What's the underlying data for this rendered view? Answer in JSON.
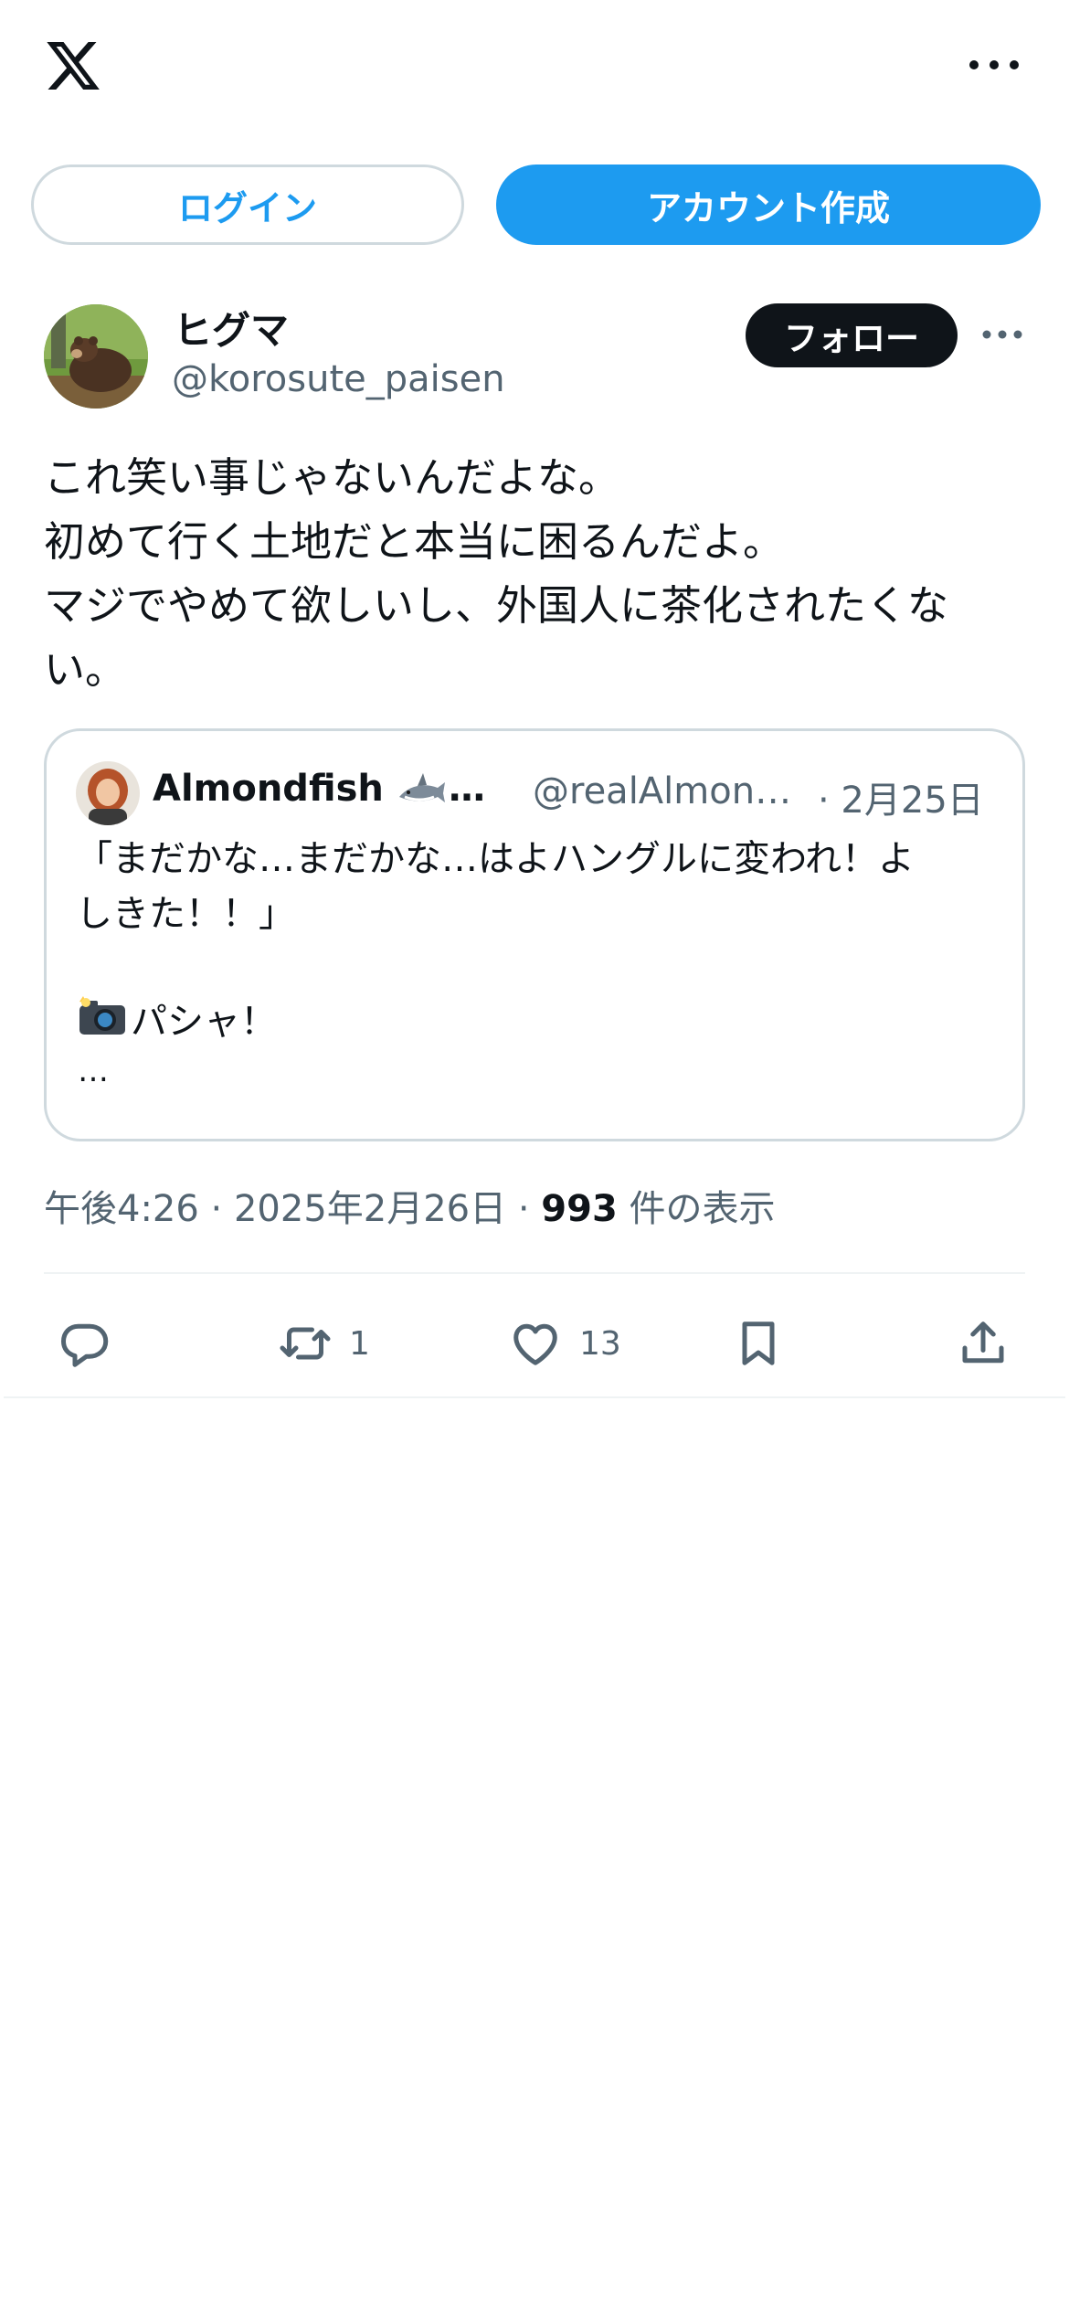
{
  "header": {
    "logo_icon": "x-logo-icon",
    "more_icon": "more-horizontal-icon"
  },
  "auth": {
    "login_label": "ログイン",
    "signup_label": "アカウント作成"
  },
  "post": {
    "display_name": "ヒグマ",
    "handle": "@korosute_paisen",
    "follow_label": "フォロー",
    "text": "これ笑い事じゃないんだよな。\n初めて行く土地だと本当に困るんだよ。\nマジでやめて欲しいし、外国人に茶化されたくな\nい。",
    "quote": {
      "display_name": "Almondfish",
      "name_suffix": "…",
      "handle": "@realAlmon…",
      "date": "· 2月25日",
      "text": "「まだかな…まだかな…はよハングルに変われ！よ\nしきた！！」",
      "camera_text": "パシャ！",
      "more_text": "…"
    },
    "meta": {
      "time": "午後4:26",
      "separator": " · ",
      "date": "2025年2月26日",
      "views_count": "993",
      "views_label": " 件の表示"
    },
    "actions": {
      "reply_icon": "reply-icon",
      "retweet_icon": "retweet-icon",
      "retweet_count": "1",
      "like_icon": "heart-icon",
      "like_count": "13",
      "bookmark_icon": "bookmark-icon",
      "share_icon": "share-icon"
    }
  },
  "colors": {
    "accent": "#1d9bf0",
    "text": "#0f1419",
    "secondary_text": "#536471",
    "border": "#cfd9de"
  }
}
